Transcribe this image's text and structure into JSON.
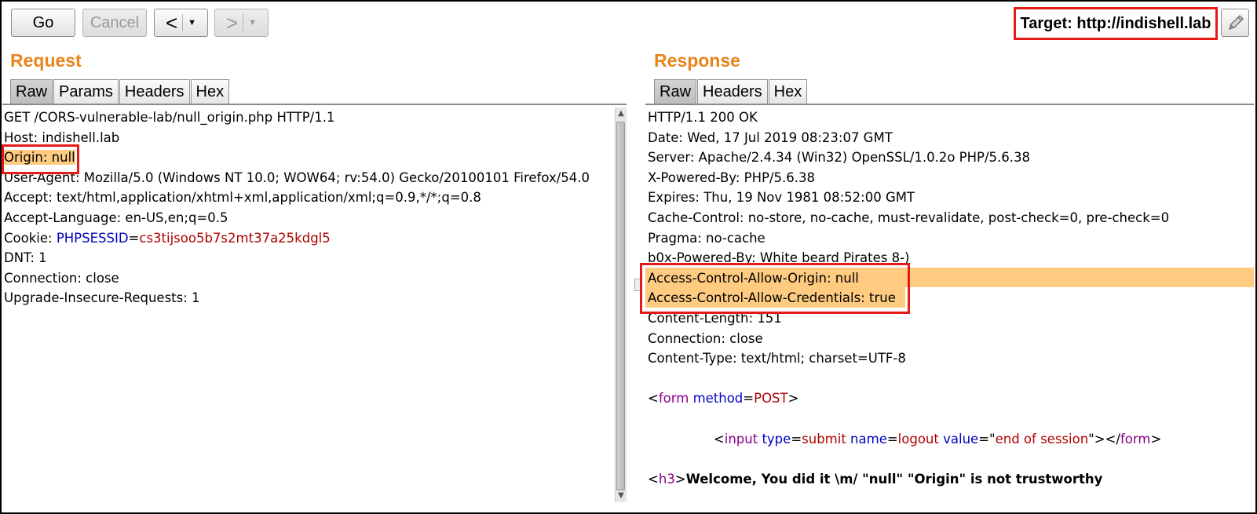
{
  "toolbar": {
    "go_label": "Go",
    "cancel_label": "Cancel",
    "back_symbol": "<",
    "forward_symbol": ">",
    "dropdown_symbol": "▼",
    "target_label": "Target: http://indishell.lab",
    "edit_icon": "pencil-icon"
  },
  "request": {
    "title": "Request",
    "tabs": [
      "Raw",
      "Params",
      "Headers",
      "Hex"
    ],
    "active_tab": "Raw",
    "lines": [
      "GET /CORS-vulnerable-lab/null_origin.php HTTP/1.1",
      "Host: indishell.lab",
      "Origin: null",
      "User-Agent: Mozilla/5.0 (Windows NT 10.0; WOW64; rv:54.0) Gecko/20100101 Firefox/54.0",
      "Accept: text/html,application/xhtml+xml,application/xml;q=0.9,*/*;q=0.8",
      "Accept-Language: en-US,en;q=0.5",
      "DNT: 1",
      "Connection: close",
      "Upgrade-Insecure-Requests: 1"
    ],
    "cookie": {
      "label": "Cookie: ",
      "name": "PHPSESSID",
      "eq": "=",
      "value": "cs3tijsoo5b7s2mt37a25kdgl5"
    }
  },
  "response": {
    "title": "Response",
    "tabs": [
      "Raw",
      "Headers",
      "Hex"
    ],
    "active_tab": "Raw",
    "lines": [
      "HTTP/1.1 200 OK",
      "Date: Wed, 17 Jul 2019 08:23:07 GMT",
      "Server: Apache/2.4.34 (Win32) OpenSSL/1.0.2o PHP/5.6.38",
      "X-Powered-By: PHP/5.6.38",
      "Expires: Thu, 19 Nov 1981 08:52:00 GMT",
      "Cache-Control: no-store, no-cache, must-revalidate, post-check=0, pre-check=0",
      "Pragma: no-cache",
      "b0x-Powered-By: White beard Pirates 8-)",
      "Access-Control-Allow-Origin: null",
      "Access-Control-Allow-Credentials: true",
      "Content-Length: 151",
      "Connection: close",
      "Content-Type: text/html; charset=UTF-8"
    ],
    "form": {
      "lt": "<",
      "tag": "form",
      "attr": "method",
      "eq": "=",
      "val": "POST",
      "gt": ">"
    },
    "input": {
      "lt": "<",
      "tag": "input",
      "a1": "type",
      "v1": "submit",
      "a2": "name",
      "v2": "logout",
      "a3": "value",
      "q": "\"",
      "v3": "end of session",
      "close": "\"></",
      "ctag": "form",
      "gt": ">"
    },
    "h3": {
      "lt": "<",
      "tag": "h3",
      "gt": ">",
      "text": "Welcome, You did it \\m/ \"null\" \"Origin\" is not trustworthy"
    }
  },
  "colors": {
    "accent_orange": "#e8841a",
    "highlight": "#fecb80",
    "annotation_red": "#e41b17"
  }
}
